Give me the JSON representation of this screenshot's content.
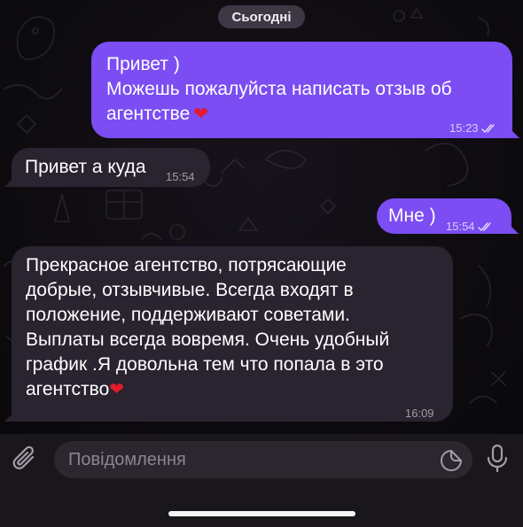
{
  "date_separator": "Сьогодні",
  "messages": [
    {
      "direction": "outgoing",
      "lines": [
        "Привет )",
        "Можешь пожалуйста написать отзыв об",
        "агентстве"
      ],
      "emoji": "heart",
      "time": "15:23",
      "status": "read"
    },
    {
      "direction": "incoming",
      "lines": [
        "Привет а куда"
      ],
      "time": "15:54"
    },
    {
      "direction": "outgoing",
      "lines": [
        "Мне )"
      ],
      "time": "15:54",
      "status": "read"
    },
    {
      "direction": "incoming",
      "lines": [
        "Прекрасное агентство, потрясающие",
        "добрые, отзывчивые. Всегда входят в",
        "положение, поддерживают советами.",
        "Выплаты всегда вовремя.  Очень удобный",
        "график .Я довольна тем что попала в это",
        "агентство"
      ],
      "emoji": "heart",
      "time": "16:09"
    }
  ],
  "composer": {
    "placeholder": "Повідомлення",
    "icons": [
      "paperclip-icon",
      "sticker-icon",
      "microphone-icon"
    ]
  },
  "colors": {
    "outgoing_bubble": "#7b4df2",
    "incoming_bubble": "#2a2330",
    "heart": "#e3192c",
    "background": "#0b0b0d"
  }
}
